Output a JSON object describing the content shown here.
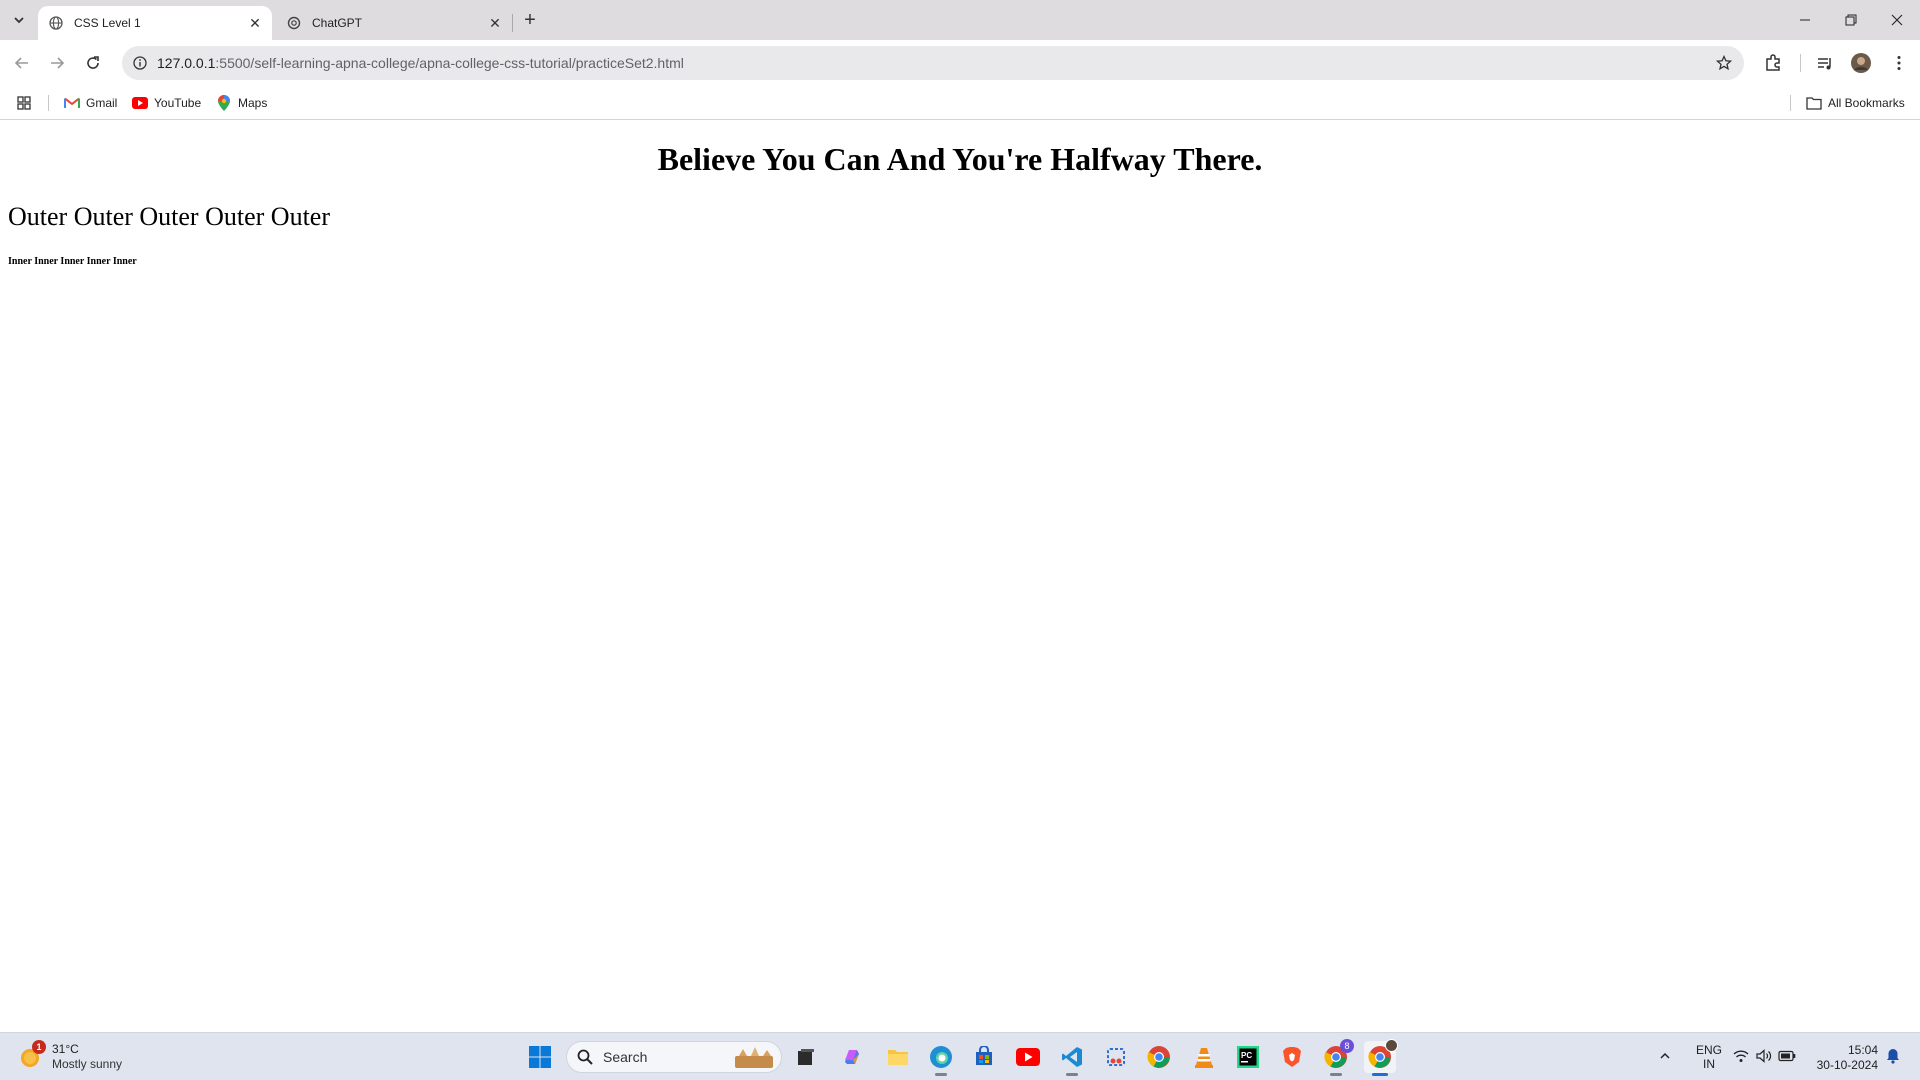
{
  "browser": {
    "tabs": [
      {
        "title": "CSS Level 1",
        "active": true
      },
      {
        "title": "ChatGPT",
        "active": false
      }
    ],
    "url_host": "127.0.0.1",
    "url_path": ":5500/self-learning-apna-college/apna-college-css-tutorial/practiceSet2.html",
    "bookmarks": [
      {
        "label": "Gmail",
        "icon": "gmail-icon"
      },
      {
        "label": "YouTube",
        "icon": "youtube-icon"
      },
      {
        "label": "Maps",
        "icon": "maps-icon"
      }
    ],
    "all_bookmarks_label": "All Bookmarks"
  },
  "page": {
    "heading": "Believe You Can And You're Halfway There.",
    "outer_text": "Outer Outer Outer Outer Outer",
    "inner_text": "Inner Inner Inner Inner Inner"
  },
  "taskbar": {
    "weather_temp": "31°C",
    "weather_cond": "Mostly sunny",
    "weather_badge": "1",
    "search_label": "Search",
    "lang_line1": "ENG",
    "lang_line2": "IN",
    "time": "15:04",
    "date": "30-10-2024",
    "chrome_badge": "8"
  },
  "colors": {
    "tabstrip_bg": "#dedcde",
    "omnibox_bg": "#e9e9ec",
    "taskbar_bg": "#dfe4ee",
    "accent": "#1b6fd6"
  }
}
